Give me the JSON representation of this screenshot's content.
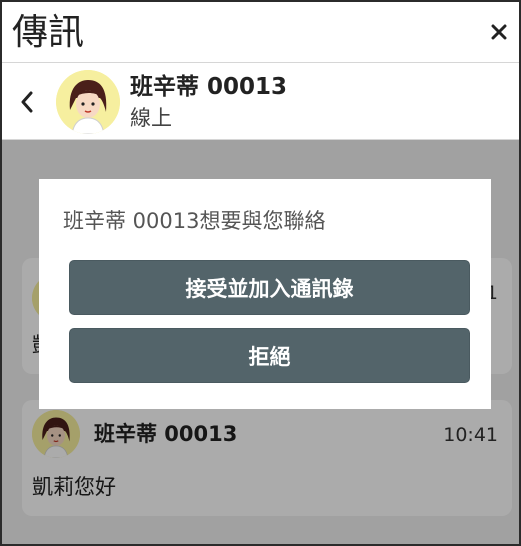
{
  "window": {
    "title": "傳訊",
    "close_icon": "close-icon"
  },
  "contact": {
    "name": "班辛蒂 00013",
    "status": "線上",
    "back_icon": "chevron-left-icon",
    "avatar_icon": "avatar-icon"
  },
  "messages": [
    {
      "sender": "班辛蒂 00013",
      "time": "10:41",
      "text": "凱莉您好"
    }
  ],
  "partial_message": {
    "text_fragment": "凱",
    "time_fragment": "1"
  },
  "dialog": {
    "message": "班辛蒂 00013想要與您聯絡",
    "accept_label": "接受並加入通訊錄",
    "reject_label": "拒絕"
  },
  "colors": {
    "button_bg": "#53646a",
    "avatar_bg": "#f6ef9f",
    "overlay": "rgba(0,0,0,0.33)"
  }
}
